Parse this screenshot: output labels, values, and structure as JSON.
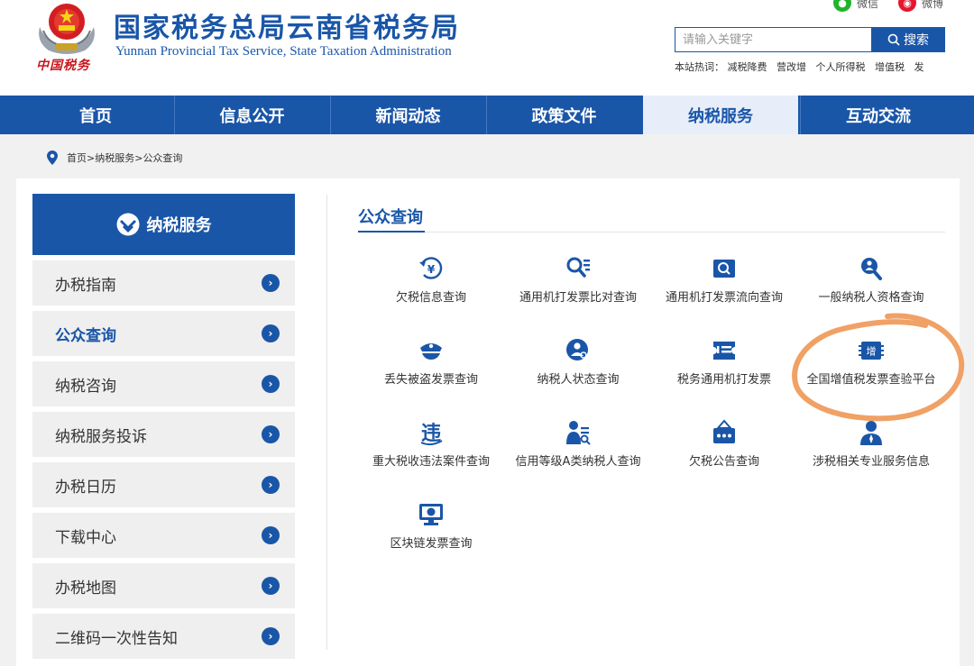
{
  "header": {
    "title": "国家税务总局云南省税务局",
    "subtitle": "Yunnan Provincial Tax Service, State Taxation Administration",
    "emblem_caption": "中国税务",
    "social": [
      {
        "label": "微信",
        "icon": "wechat-icon"
      },
      {
        "label": "微博",
        "icon": "weibo-icon"
      }
    ],
    "search": {
      "placeholder": "请输入关键字",
      "button_label": "搜索"
    },
    "hot_words_label": "本站热词：",
    "hot_words": [
      "减税降费",
      "营改增",
      "个人所得税",
      "增值税",
      "发"
    ]
  },
  "nav": {
    "items": [
      "首页",
      "信息公开",
      "新闻动态",
      "政策文件",
      "纳税服务",
      "互动交流"
    ],
    "active": "纳税服务"
  },
  "breadcrumb": {
    "home": "首页",
    "sep": "> ",
    "level1": "纳税服务",
    "current": "公众查询"
  },
  "sidebar": {
    "title": "纳税服务",
    "items": [
      "办税指南",
      "公众查询",
      "纳税咨询",
      "纳税服务投诉",
      "办税日历",
      "下载中心",
      "办税地图",
      "二维码一次性告知"
    ],
    "active": "公众查询"
  },
  "main": {
    "section_title": "公众查询",
    "services": [
      {
        "label": "欠税信息查询",
        "icon": "tax-yuan-icon"
      },
      {
        "label": "通用机打发票比对查询",
        "icon": "search-list-icon"
      },
      {
        "label": "通用机打发票流向查询",
        "icon": "invoice-flow-icon"
      },
      {
        "label": "一般纳税人资格查询",
        "icon": "magnifier-person-icon"
      },
      {
        "label": "丢失被盗发票查询",
        "icon": "police-cap-icon"
      },
      {
        "label": "纳税人状态查询",
        "icon": "person-search-icon"
      },
      {
        "label": "税务通用机打发票",
        "icon": "ticket-icon"
      },
      {
        "label": "全国增值税发票查验平台",
        "icon": "vat-invoice-icon",
        "badge": "增"
      },
      {
        "label": "重大税收违法案件查询",
        "icon": "tax-law-icon",
        "badge": "违"
      },
      {
        "label": "信用等级A类纳税人查询",
        "icon": "credit-person-icon"
      },
      {
        "label": "欠税公告查询",
        "icon": "notice-board-icon"
      },
      {
        "label": "涉税相关专业服务信息",
        "icon": "professional-person-icon"
      },
      {
        "label": "区块链发票查询",
        "icon": "blockchain-monitor-icon"
      }
    ]
  },
  "colors": {
    "brand_blue": "#1a56a8",
    "nav_active_bg": "#e7eefa",
    "highlight": "#f0a165"
  }
}
